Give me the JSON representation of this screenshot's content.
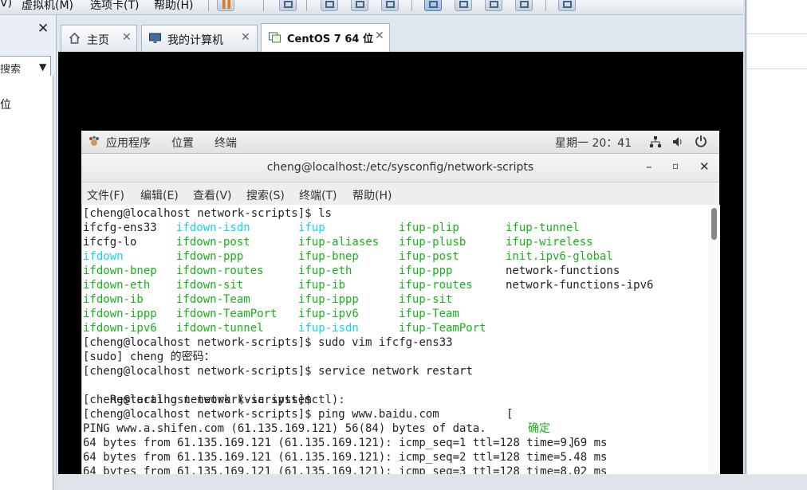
{
  "host": {
    "menus": [
      "V)",
      "虚拟机(M)",
      "选项卡(T)",
      "帮助(H)"
    ],
    "sidebar": {
      "search_placeholder": "搜索",
      "tree_item": "位",
      "close": "✕"
    },
    "tabs": [
      {
        "label": "主页",
        "icon": "home-icon"
      },
      {
        "label": "我的计算机",
        "icon": "computer-icon"
      },
      {
        "label": "CentOS 7 64 位",
        "icon": "vm-icon",
        "active": true
      }
    ],
    "tab_close": "✕"
  },
  "gnome_panel": {
    "apps": "应用程序",
    "places": "位置",
    "terminal": "终端",
    "clock": "星期一 20：41"
  },
  "terminal": {
    "title": "cheng@localhost:/etc/sysconfig/network-scripts",
    "buttons": {
      "minimize": "–",
      "maximize": "▫",
      "close": "✕"
    },
    "menu": [
      "文件(F)",
      "编辑(E)",
      "查看(V)",
      "搜索(S)",
      "终端(T)",
      "帮助(H)"
    ],
    "prompt": "[cheng@localhost network-scripts]$ ",
    "cmd_ls": "ls",
    "ls_rows": [
      [
        "ifcfg-ens33",
        "ifdown-isdn",
        "ifup",
        "ifup-plip",
        "ifup-tunnel"
      ],
      [
        "ifcfg-lo",
        "ifdown-post",
        "ifup-aliases",
        "ifup-plusb",
        "ifup-wireless"
      ],
      [
        "ifdown",
        "ifdown-ppp",
        "ifup-bnep",
        "ifup-post",
        "init.ipv6-global"
      ],
      [
        "ifdown-bnep",
        "ifdown-routes",
        "ifup-eth",
        "ifup-ppp",
        "network-functions"
      ],
      [
        "ifdown-eth",
        "ifdown-sit",
        "ifup-ib",
        "ifup-routes",
        "network-functions-ipv6"
      ],
      [
        "ifdown-ib",
        "ifdown-Team",
        "ifup-ippp",
        "ifup-sit",
        ""
      ],
      [
        "ifdown-ippp",
        "ifdown-TeamPort",
        "ifup-ipv6",
        "ifup-Team",
        ""
      ],
      [
        "ifdown-ipv6",
        "ifdown-tunnel",
        "ifup-isdn",
        "ifup-TeamPort",
        ""
      ]
    ],
    "cmd_vim": "sudo vim ifcfg-ens33",
    "sudo_prompt": "[sudo] cheng 的密码：",
    "cmd_service": "service network restart",
    "restarting": "Restarting network (via systemctl):",
    "ok_left": "[",
    "ok_text": "确定",
    "ok_right": "]",
    "cmd_ping": "ping www.baidu.com",
    "ping_header": "PING www.a.shifen.com (61.135.169.121) 56(84) bytes of data.",
    "ping_lines": [
      "64 bytes from 61.135.169.121 (61.135.169.121): icmp_seq=1 ttl=128 time=9.69 ms",
      "64 bytes from 61.135.169.121 (61.135.169.121): icmp_seq=2 ttl=128 time=5.48 ms",
      "64 bytes from 61.135.169.121 (61.135.169.121): icmp_seq=3 ttl=128 time=8.02 ms"
    ],
    "colors": {
      "green": "#18b218",
      "cyan": "#18d0e8"
    }
  }
}
